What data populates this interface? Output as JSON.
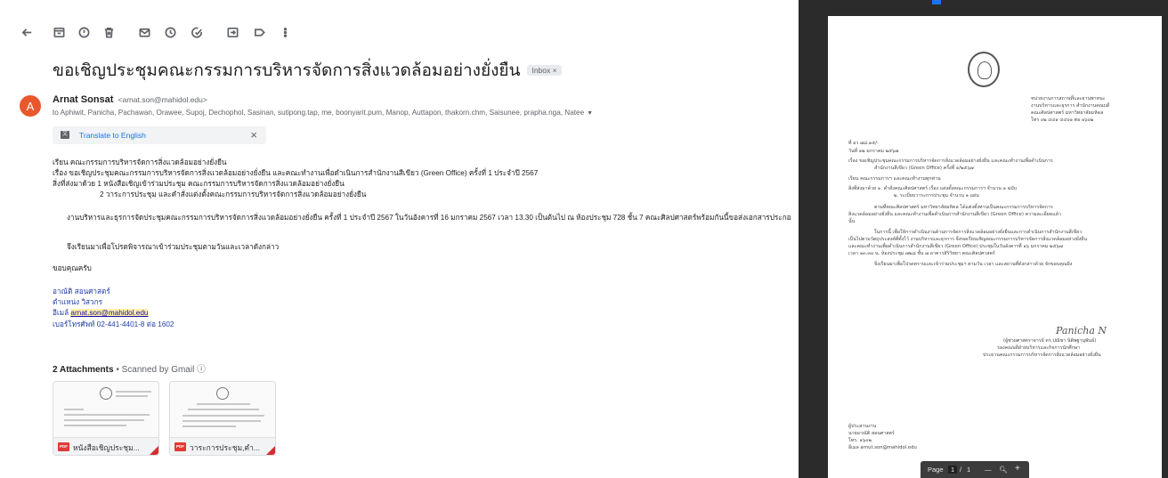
{
  "gmail": {
    "subject": "ขอเชิญประชุมคณะกรรมการบริหารจัดการสิ่งแวดล้อมอย่างยั่งยืน",
    "inbox_label": "Inbox ×",
    "avatar_letter": "A",
    "sender_name": "Arnat Sonsat",
    "sender_email": "<arnat.son@mahidol.edu>",
    "recipients": "to Aphiwit, Panicha, Pachawan, Orawee, Supoj, Dechophol, Sasinan, sutipong.tap, me, boonyarit.pum, Manop, Auttapon, thakorn.chm, Saisunee, prapha.nga, Natee",
    "translate_label": "Translate to English",
    "close_glyph": "×",
    "body": {
      "line1": "เรียน คณะกรรมการบริหารจัดการสิ่งแวดล้อมอย่างยั่งยืน",
      "line2": "เรื่อง ขอเชิญประชุมคณะกรรมการบริหารจัดการสิ่งแวดล้อมอย่างยั่งยืน และคณะทำงานเพื่อดำเนินการสำนักงานสีเขียว (Green Office) ครั้งที่ 1 ประจำปี 2567",
      "line3": "สิ่งที่ส่งมาด้วย 1 หนังสือเชิญเข้าร่วมประชุม คณะกรรมการบริหารจัดการสิ่งแวดล้อมอย่างยั่งยืน",
      "line4": "2 วาระการประชุม และคำสั่งแต่งตั้งคณะกรรมการบริหารจัดการสิ่งแวดล้อมอย่างยั่งยืน",
      "para1": "งานบริหารและธุรการจัดประชุมคณะกรรมการบริหารจัดการสิ่งแวดล้อมอย่างยั่งยืน  ครั้งที่ 1 ประจำปี 2567 ในวันอังคารที่ 16 มกราคม 2567 เวลา 13.30 เป็นต้นไป ณ ห้องประชุม 728 ชั้น 7 คณะศิลปศาสตร์พร้อมกันนี้ขอส่งเอกสารประกอ",
      "para2": "จึงเรียนมาเพื่อโปรดพิจารณาเข้าร่วมประชุมตามวันและเวลาดังกล่าว",
      "thanks": "ขอบคุณครับ",
      "sig_name": "อาณัติ สอนศาสตร์",
      "sig_title": "ตำแหน่ง วิสวกร",
      "sig_email_label": "อีเมล์ ",
      "sig_email": "arnat.son@mahidol.edu",
      "sig_phone": "เบอร์โทรศัพท์ 02-441-4401-8 ต่อ 1602"
    },
    "attachments_title": "2 Attachments",
    "attachments_sub": "  •  Scanned by Gmail ⓘ",
    "attachments": [
      {
        "name": "หนังสือเชิญประชุม...",
        "badge": "PDF"
      },
      {
        "name": "วาระการประชุม,คำ...",
        "badge": "PDF"
      }
    ]
  },
  "pdf": {
    "header": [
      "หน่วยงานการสถานที่และยานพาหนะ",
      "งานบริหารและธุรการ สำนักงานคณบดี",
      "คณะศิลปศาสตร์  มหาวิทยาลัยมหิดล",
      "โทร ๐๒ ๔๔๑ ๔๔๐๑ ต่อ ๑๖๐๒"
    ],
    "ref_no": "ที่  อว ๗๘.๑๕/-",
    "date": "วันที่    ๑๒ มกราคม ๒๕๖๗",
    "subject_1": "เรื่อง    ขอเชิญประชุมคณะกรรมการบริหารจัดการสิ่งแวดล้อมอย่างยั่งยืน และคณะทำงานเพื่อดำเนินการ",
    "subject_2": "สำนักงานสีเขียว (Green Office) ครั้งที่ ๑/๒๕๖๗",
    "to": "เรียน    คณะกรรมการฯ และคณะทำงานทุกท่าน",
    "encl_1": "สิ่งที่ส่งมาด้วย    ๑. คำสั่งคณะศิลปศาสตร์ เรื่อง แต่งตั้งคณะกรรมการฯ  จำนวน  ๑ ฉบับ",
    "encl_2": "๒. ระเบียบวาระการประชุม  จำนวน  ๑ แผ่น",
    "p1_1": "ตามที่คณะศิลปศาสตร์ มหาวิทยาลัยมหิดล ได้แต่งตั้งท่านเป็นคณะกรรมการบริหารจัดการ",
    "p1_2": "สิ่งแวดล้อมอย่างยั่งยืน และคณะทำงานเพื่อดำเนินการสำนักงานสีเขียว (Green Office) ความละเอียดแล้ว",
    "p1_3": "นั้น",
    "p2_1": "ในการนี้ เพื่อให้การดำเนินงานด้านการจัดการสิ่งแวดล้อมอย่างยั่งยืนและการดำเนินการสำนักงานสีเขียว",
    "p2_2": "เป็นไปตามวัตถุประสงค์ที่ตั้งไว้ งานบริหารและธุรการ จึงขอเรียนเชิญคณะกรรมการบริหารจัดการสิ่งแวดล้อมอย่างยั่งยืน",
    "p2_3": "และคณะทำงานเพื่อดำเนินการสำนักงานสีเขียว (Green Office) ประชุมในวันอังคารที่ ๑๖ มกราคม ๒๕๖๗",
    "p2_4": "เวลา ๑๓.๓๐ น. ห้องประชุม ๗๒๘ ชั้น ๗ อาคารสิริวิทยา คณะศิลปศาสตร์",
    "p3": "จึงเรียนมาเพื่อโปรดทราบและเข้าร่วมประชุมฯ ตามวัน เวลา และสถานที่ดังกล่าวด้วย จักขอบคุณยิ่ง",
    "signature": "Panicha  N",
    "signer_1": "(ผู้ช่วยศาสตราจารย์ ดร.ปณิชา นิติพฐานุพันธ์)",
    "signer_2": "รองคณบดีฝ่ายบริหารและกิจการนักศึกษา",
    "signer_3": "ประธานคณะกรรมการบริหารจัดการสิ่งแวดล้อมอย่างยั่งยืน",
    "contact_1": "ผู้ประสานงาน",
    "contact_2": "นายอาณัติ สอนศาสตร์",
    "contact_3": "โทร. ๑๖๐๒",
    "contact_4": "อีเมล arnut.son@mahidol.edu",
    "pager": {
      "label": "Page",
      "current": "1",
      "sep": "/",
      "total": "1",
      "minus": "—",
      "zoom_icon": "🔍",
      "plus": "+"
    }
  },
  "icons": [
    "back-arrow-icon",
    "archive-icon",
    "report-spam-icon",
    "delete-icon",
    "mark-unread-icon",
    "snooze-icon",
    "add-to-tasks-icon",
    "move-to-icon",
    "label-icon",
    "more-vert-icon",
    "translate-icon",
    "pdf-icon",
    "university-crest-icon"
  ]
}
